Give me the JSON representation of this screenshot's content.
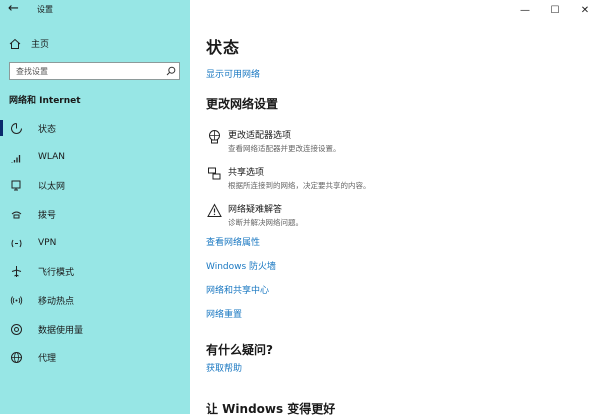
{
  "app": {
    "title": "设置"
  },
  "titlebar": {
    "back_icon": "back-arrow-icon",
    "minimize": "—",
    "maximize": "☐",
    "close": "✕"
  },
  "sidebar": {
    "home_label": "主页",
    "search_placeholder": "查找设置",
    "section": "网络和 Internet",
    "items": [
      {
        "label": "状态",
        "icon": "status-icon",
        "active": true
      },
      {
        "label": "WLAN",
        "icon": "wifi-icon"
      },
      {
        "label": "以太网",
        "icon": "ethernet-icon"
      },
      {
        "label": "拨号",
        "icon": "dialup-icon"
      },
      {
        "label": "VPN",
        "icon": "vpn-icon"
      },
      {
        "label": "飞行模式",
        "icon": "airplane-icon"
      },
      {
        "label": "移动热点",
        "icon": "hotspot-icon"
      },
      {
        "label": "数据使用量",
        "icon": "data-usage-icon"
      },
      {
        "label": "代理",
        "icon": "proxy-globe-icon"
      }
    ]
  },
  "main": {
    "title": "状态",
    "show_networks": "显示可用网络",
    "change_settings": "更改网络设置",
    "options": [
      {
        "title": "更改适配器选项",
        "desc": "查看网络适配器并更改连接设置。",
        "icon": "adapter-icon"
      },
      {
        "title": "共享选项",
        "desc": "根据所连接到的网络，决定要共享的内容。",
        "icon": "sharing-icon"
      },
      {
        "title": "网络疑难解答",
        "desc": "诊断并解决网络问题。",
        "icon": "warning-icon"
      }
    ],
    "links": [
      "查看网络属性",
      "Windows 防火墙",
      "网络和共享中心",
      "网络重置"
    ],
    "question": "有什么疑问?",
    "get_help": "获取帮助",
    "improve": "让 Windows 变得更好"
  },
  "colors": {
    "sidebar_bg": "#97e6e5",
    "link": "#1a78c2",
    "accent": "#0a2a6b"
  }
}
